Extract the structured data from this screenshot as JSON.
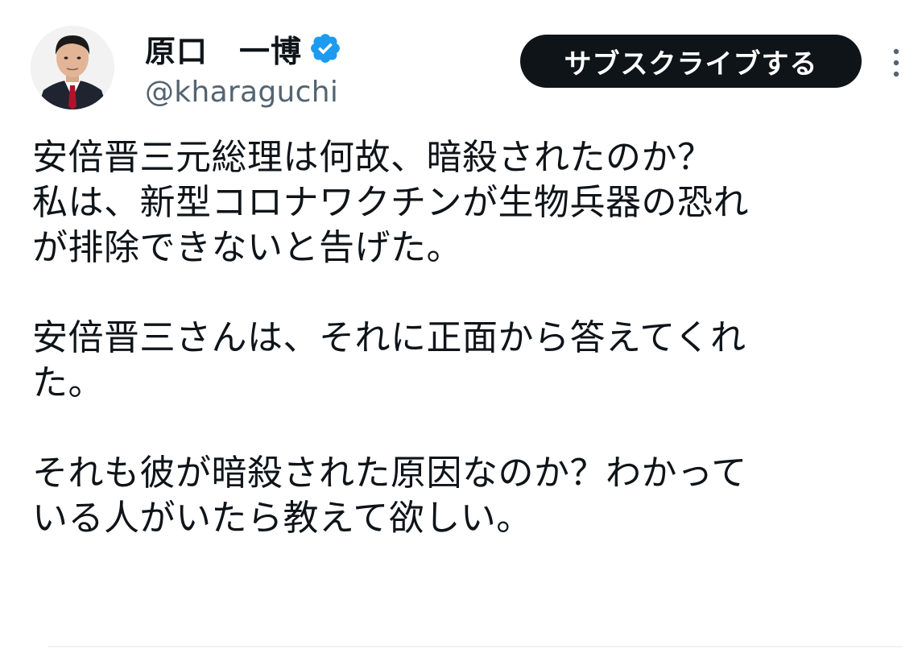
{
  "author": {
    "display_name": "原口　一博",
    "handle": "@kharaguchi",
    "verified": true,
    "verified_color": "#1d9bf0"
  },
  "header": {
    "subscribe_label": "サブスクライブする",
    "more_icon": "more-vertical-icon"
  },
  "tweet": {
    "paragraphs": [
      {
        "lines": [
          "安倍晋三元総理は何故、暗殺されたのか？",
          "私は、新型コロナワクチンが生物兵器の恐れ",
          "が排除できないと告げた。"
        ]
      },
      {
        "lines": [
          "安倍晋三さんは、それに正面から答えてくれ",
          "た。"
        ]
      },
      {
        "lines": [
          "それも彼が暗殺された原因なのか？わかって",
          "いる人がいたら教えて欲しい。"
        ]
      }
    ]
  },
  "colors": {
    "text": "#0f1419",
    "secondary_text": "#536471",
    "button_bg": "#0f1419",
    "button_text": "#ffffff"
  }
}
